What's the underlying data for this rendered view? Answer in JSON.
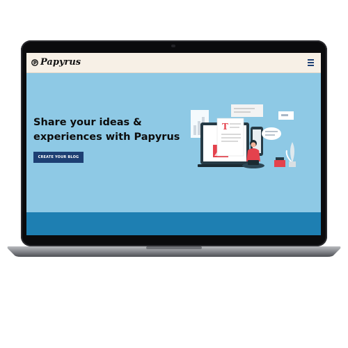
{
  "navbar": {
    "brand": "Papyrus",
    "logo_icon": "papyrus-logo-icon",
    "menu_icon": "hamburger-menu-icon"
  },
  "hero": {
    "title": "Share your ideas & experiences with Papyrus",
    "cta_label": "CREATE YOUR BLOG",
    "illustration_icon": "blogging-person-with-laptop-illustration"
  },
  "colors": {
    "hero_background": "#8ec9e5",
    "navbar_background": "#f7f0e6",
    "cta_background": "#1d3f73",
    "footer_band": "#1e7fb2",
    "bezel": "#0b0b0d",
    "laptop_body": "#7d7f84"
  }
}
